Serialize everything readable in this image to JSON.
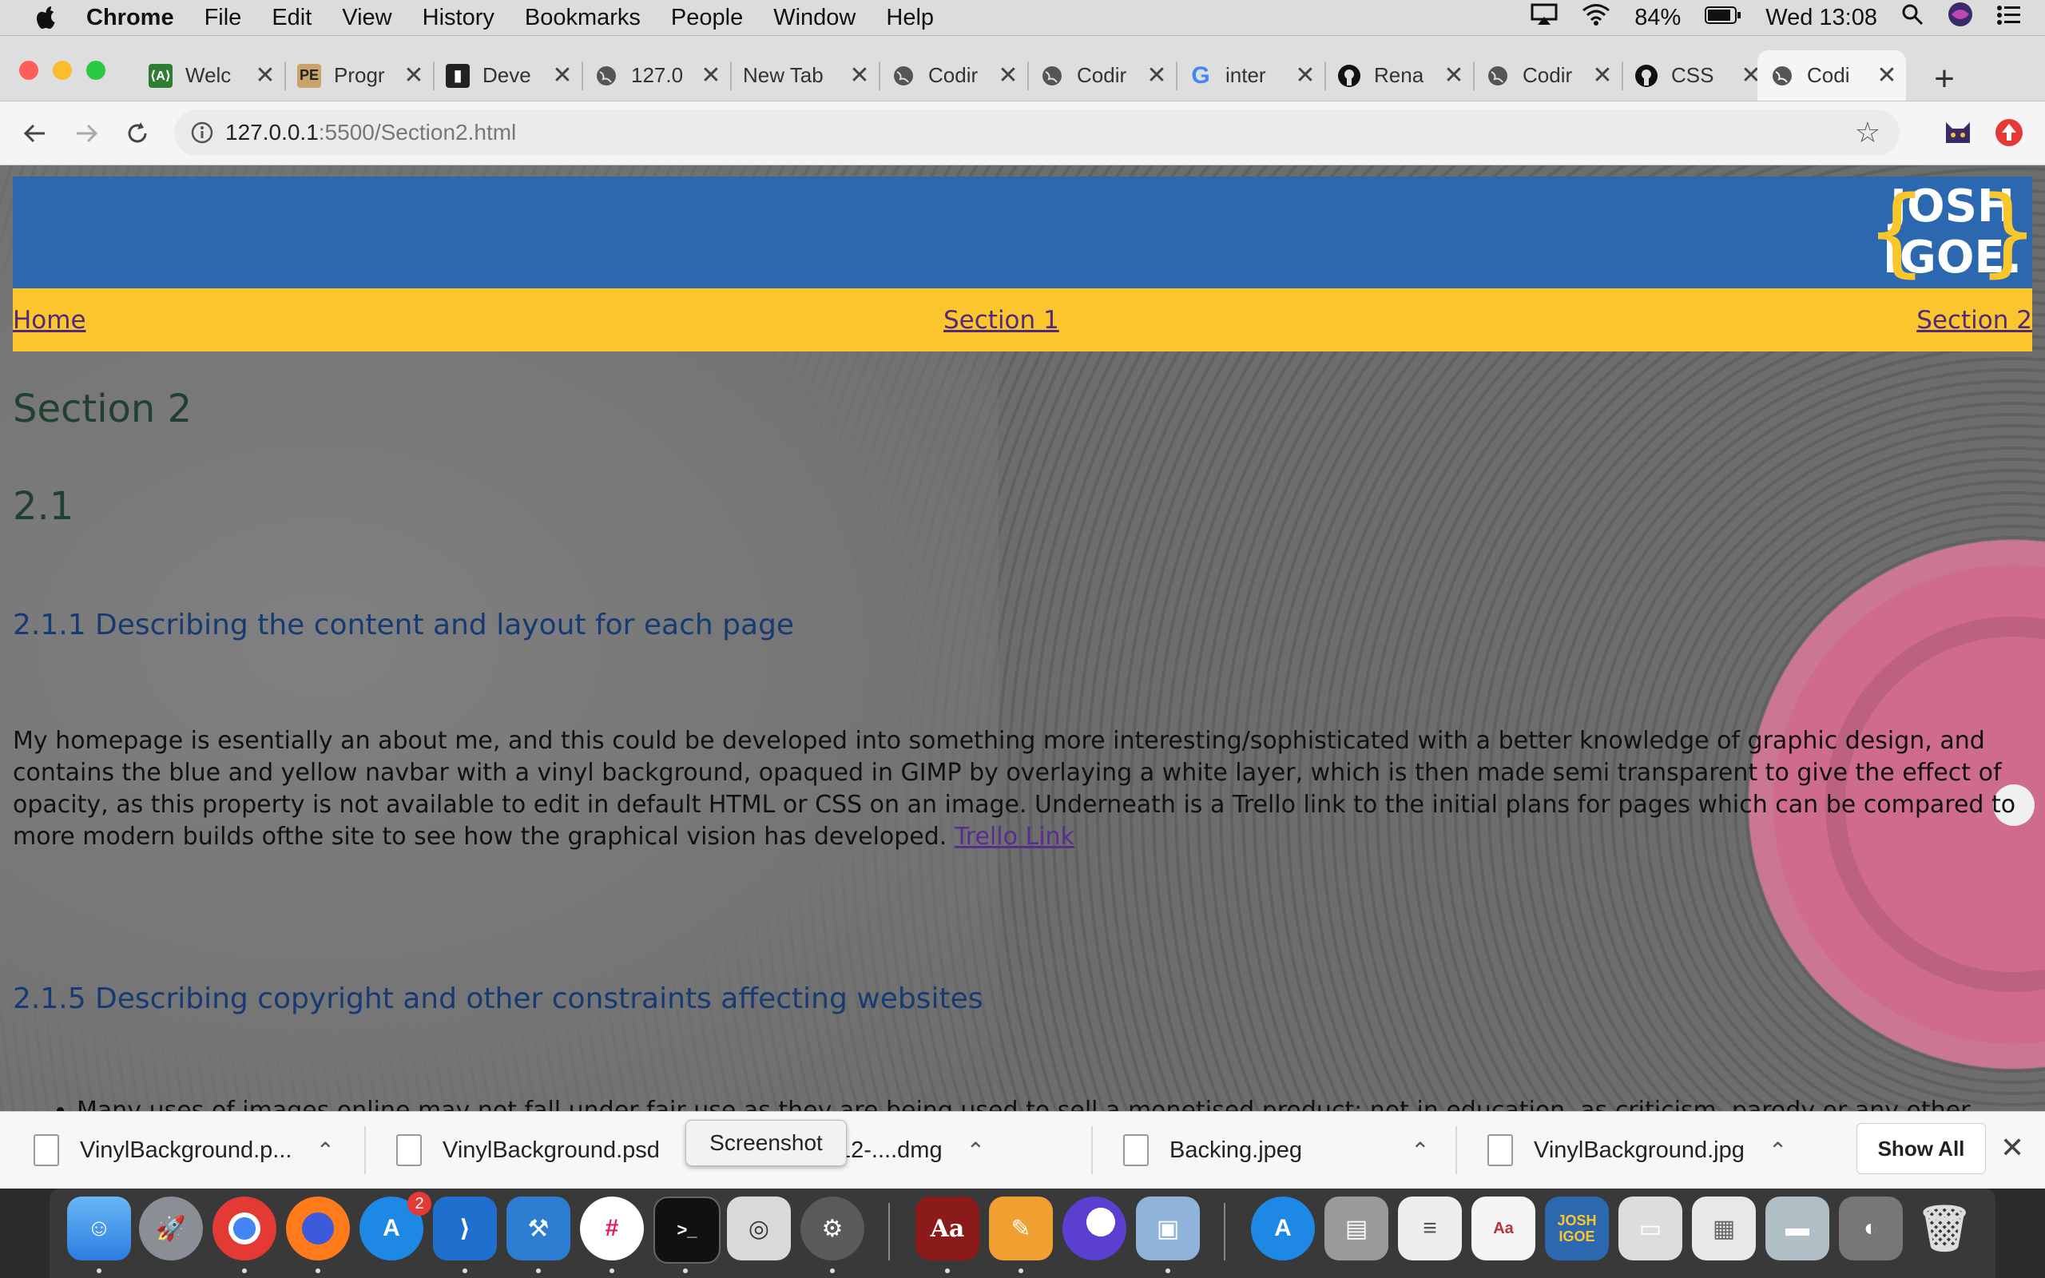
{
  "menubar": {
    "app": "Chrome",
    "items": [
      "File",
      "Edit",
      "View",
      "History",
      "Bookmarks",
      "People",
      "Window",
      "Help"
    ],
    "battery": "84%",
    "clock": "Wed 13:08"
  },
  "tabs": [
    {
      "title": "Welc",
      "icon": "file-icon"
    },
    {
      "title": "Progr",
      "icon": "pe-icon"
    },
    {
      "title": "Deve",
      "icon": "dev-icon"
    },
    {
      "title": "127.0",
      "icon": "globe-icon"
    },
    {
      "title": "New Tab",
      "icon": "none"
    },
    {
      "title": "Codir",
      "icon": "globe-icon"
    },
    {
      "title": "Codir",
      "icon": "globe-icon"
    },
    {
      "title": "inter",
      "icon": "google-icon"
    },
    {
      "title": "Rena",
      "icon": "github-icon"
    },
    {
      "title": "Codir",
      "icon": "globe-icon"
    },
    {
      "title": "CSS",
      "icon": "github-icon"
    },
    {
      "title": "Codi",
      "icon": "globe-icon"
    }
  ],
  "toolbar": {
    "url_host": "127.0.0.1",
    "url_rest": ":5500/Section2.html"
  },
  "site": {
    "logo_line1": "JOSH",
    "logo_line2": "IGOE.",
    "nav": [
      "Home",
      "Section 1",
      "Section 2"
    ]
  },
  "content": {
    "h1": "Section 2",
    "h2": "2.1",
    "h3_first": "2.1.1 Describing the content and layout for each page",
    "paragraph": "My homepage is esentially an about me, and this could be developed into something more interesting/sophisticated with a better knowledge of graphic design, and contains the blue and yellow navbar with a vinyl background, opaqued in GIMP by overlaying a white layer, which is then made semi transparent to give the effect of opacity, as this property is not available to edit in default HTML or CSS on an image. Underneath is a Trello link to the initial plans for pages which can be compared to more modern builds ofthe site to see how the graphical vision has developed.",
    "link": "Trello Link",
    "h3_second": "2.1.5 Describing copyright and other constraints affecting websites",
    "bullet": "Many uses of images online may not fall under fair use as they are being used to sell a monetised product; not in education, as criticism, parody or any other exception. Many,"
  },
  "downloads": {
    "items": [
      "VinylBackground.p...",
      "VinylBackground.psd",
      "gimp-2.10.12-....dmg",
      "Backing.jpeg",
      "VinylBackground.jpg"
    ],
    "show_all": "Show All",
    "tooltip": "Screenshot"
  },
  "dock": {
    "badge": "2"
  }
}
